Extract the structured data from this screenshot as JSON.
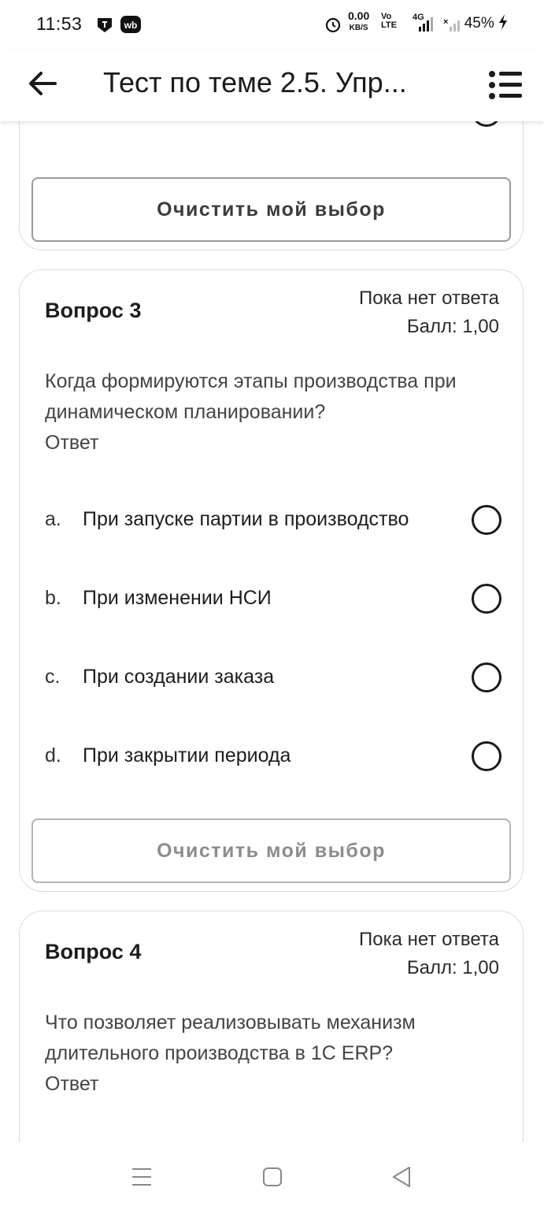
{
  "status_bar": {
    "time": "11:53",
    "net_speed": "0.00",
    "net_unit": "KB/S",
    "volte": "Vo",
    "lte": "LTE",
    "network": "4G",
    "battery": "45%"
  },
  "header": {
    "title": "Тест по теме 2.5. Упр..."
  },
  "previous_question": {
    "clear_label": "Очистить мой выбор"
  },
  "questions": [
    {
      "title": "Вопрос 3",
      "status": "Пока нет ответа",
      "score": "Балл: 1,00",
      "text": "Когда формируются этапы производства при динамическом планировании?",
      "answer_label": "Ответ",
      "options": [
        {
          "letter": "a.",
          "text": "При запуске партии в производство"
        },
        {
          "letter": "b.",
          "text": "При изменении НСИ"
        },
        {
          "letter": "c.",
          "text": "При создании заказа"
        },
        {
          "letter": "d.",
          "text": "При закрытии периода"
        }
      ],
      "clear_label": "Очистить мой выбор"
    },
    {
      "title": "Вопрос 4",
      "status": "Пока нет ответа",
      "score": "Балл: 1,00",
      "text": "Что позволяет реализовывать механизм длительного производства в 1С ERP?",
      "answer_label": "Ответ"
    }
  ],
  "colors": {
    "card_border": "#dcdcdc",
    "button_border": "#9a9a9a",
    "text_primary": "#1d1d1d",
    "text_secondary": "#444444"
  }
}
